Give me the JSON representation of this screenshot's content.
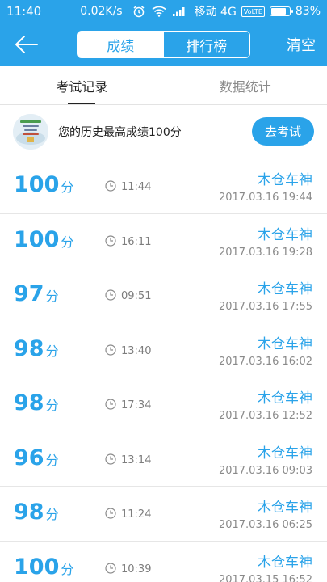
{
  "status_bar": {
    "time": "11:40",
    "network_speed": "0.02K/s",
    "carrier": "移动 4G",
    "volte": "VoLTE",
    "battery": "83%"
  },
  "header": {
    "tabs": [
      "成绩",
      "排行榜"
    ],
    "active_tab_index": 0,
    "clear_label": "清空",
    "accent_color": "#2aa3e9"
  },
  "sub_tabs": [
    "考试记录",
    "数据统计"
  ],
  "best": {
    "text": "您的历史最高成绩100分",
    "button": "去考试"
  },
  "score_unit": "分",
  "records": [
    {
      "score": "100",
      "duration": "11:44",
      "user": "木仓车神",
      "datetime": "2017.03.16  19:44"
    },
    {
      "score": "100",
      "duration": "16:11",
      "user": "木仓车神",
      "datetime": "2017.03.16  19:28"
    },
    {
      "score": "97",
      "duration": "09:51",
      "user": "木仓车神",
      "datetime": "2017.03.16  17:55"
    },
    {
      "score": "98",
      "duration": "13:40",
      "user": "木仓车神",
      "datetime": "2017.03.16  16:02"
    },
    {
      "score": "98",
      "duration": "17:34",
      "user": "木仓车神",
      "datetime": "2017.03.16  12:52"
    },
    {
      "score": "96",
      "duration": "13:14",
      "user": "木仓车神",
      "datetime": "2017.03.16  09:03"
    },
    {
      "score": "98",
      "duration": "11:24",
      "user": "木仓车神",
      "datetime": "2017.03.16  06:25"
    },
    {
      "score": "100",
      "duration": "10:39",
      "user": "木仓车神",
      "datetime": "2017.03.15  16:52"
    }
  ]
}
